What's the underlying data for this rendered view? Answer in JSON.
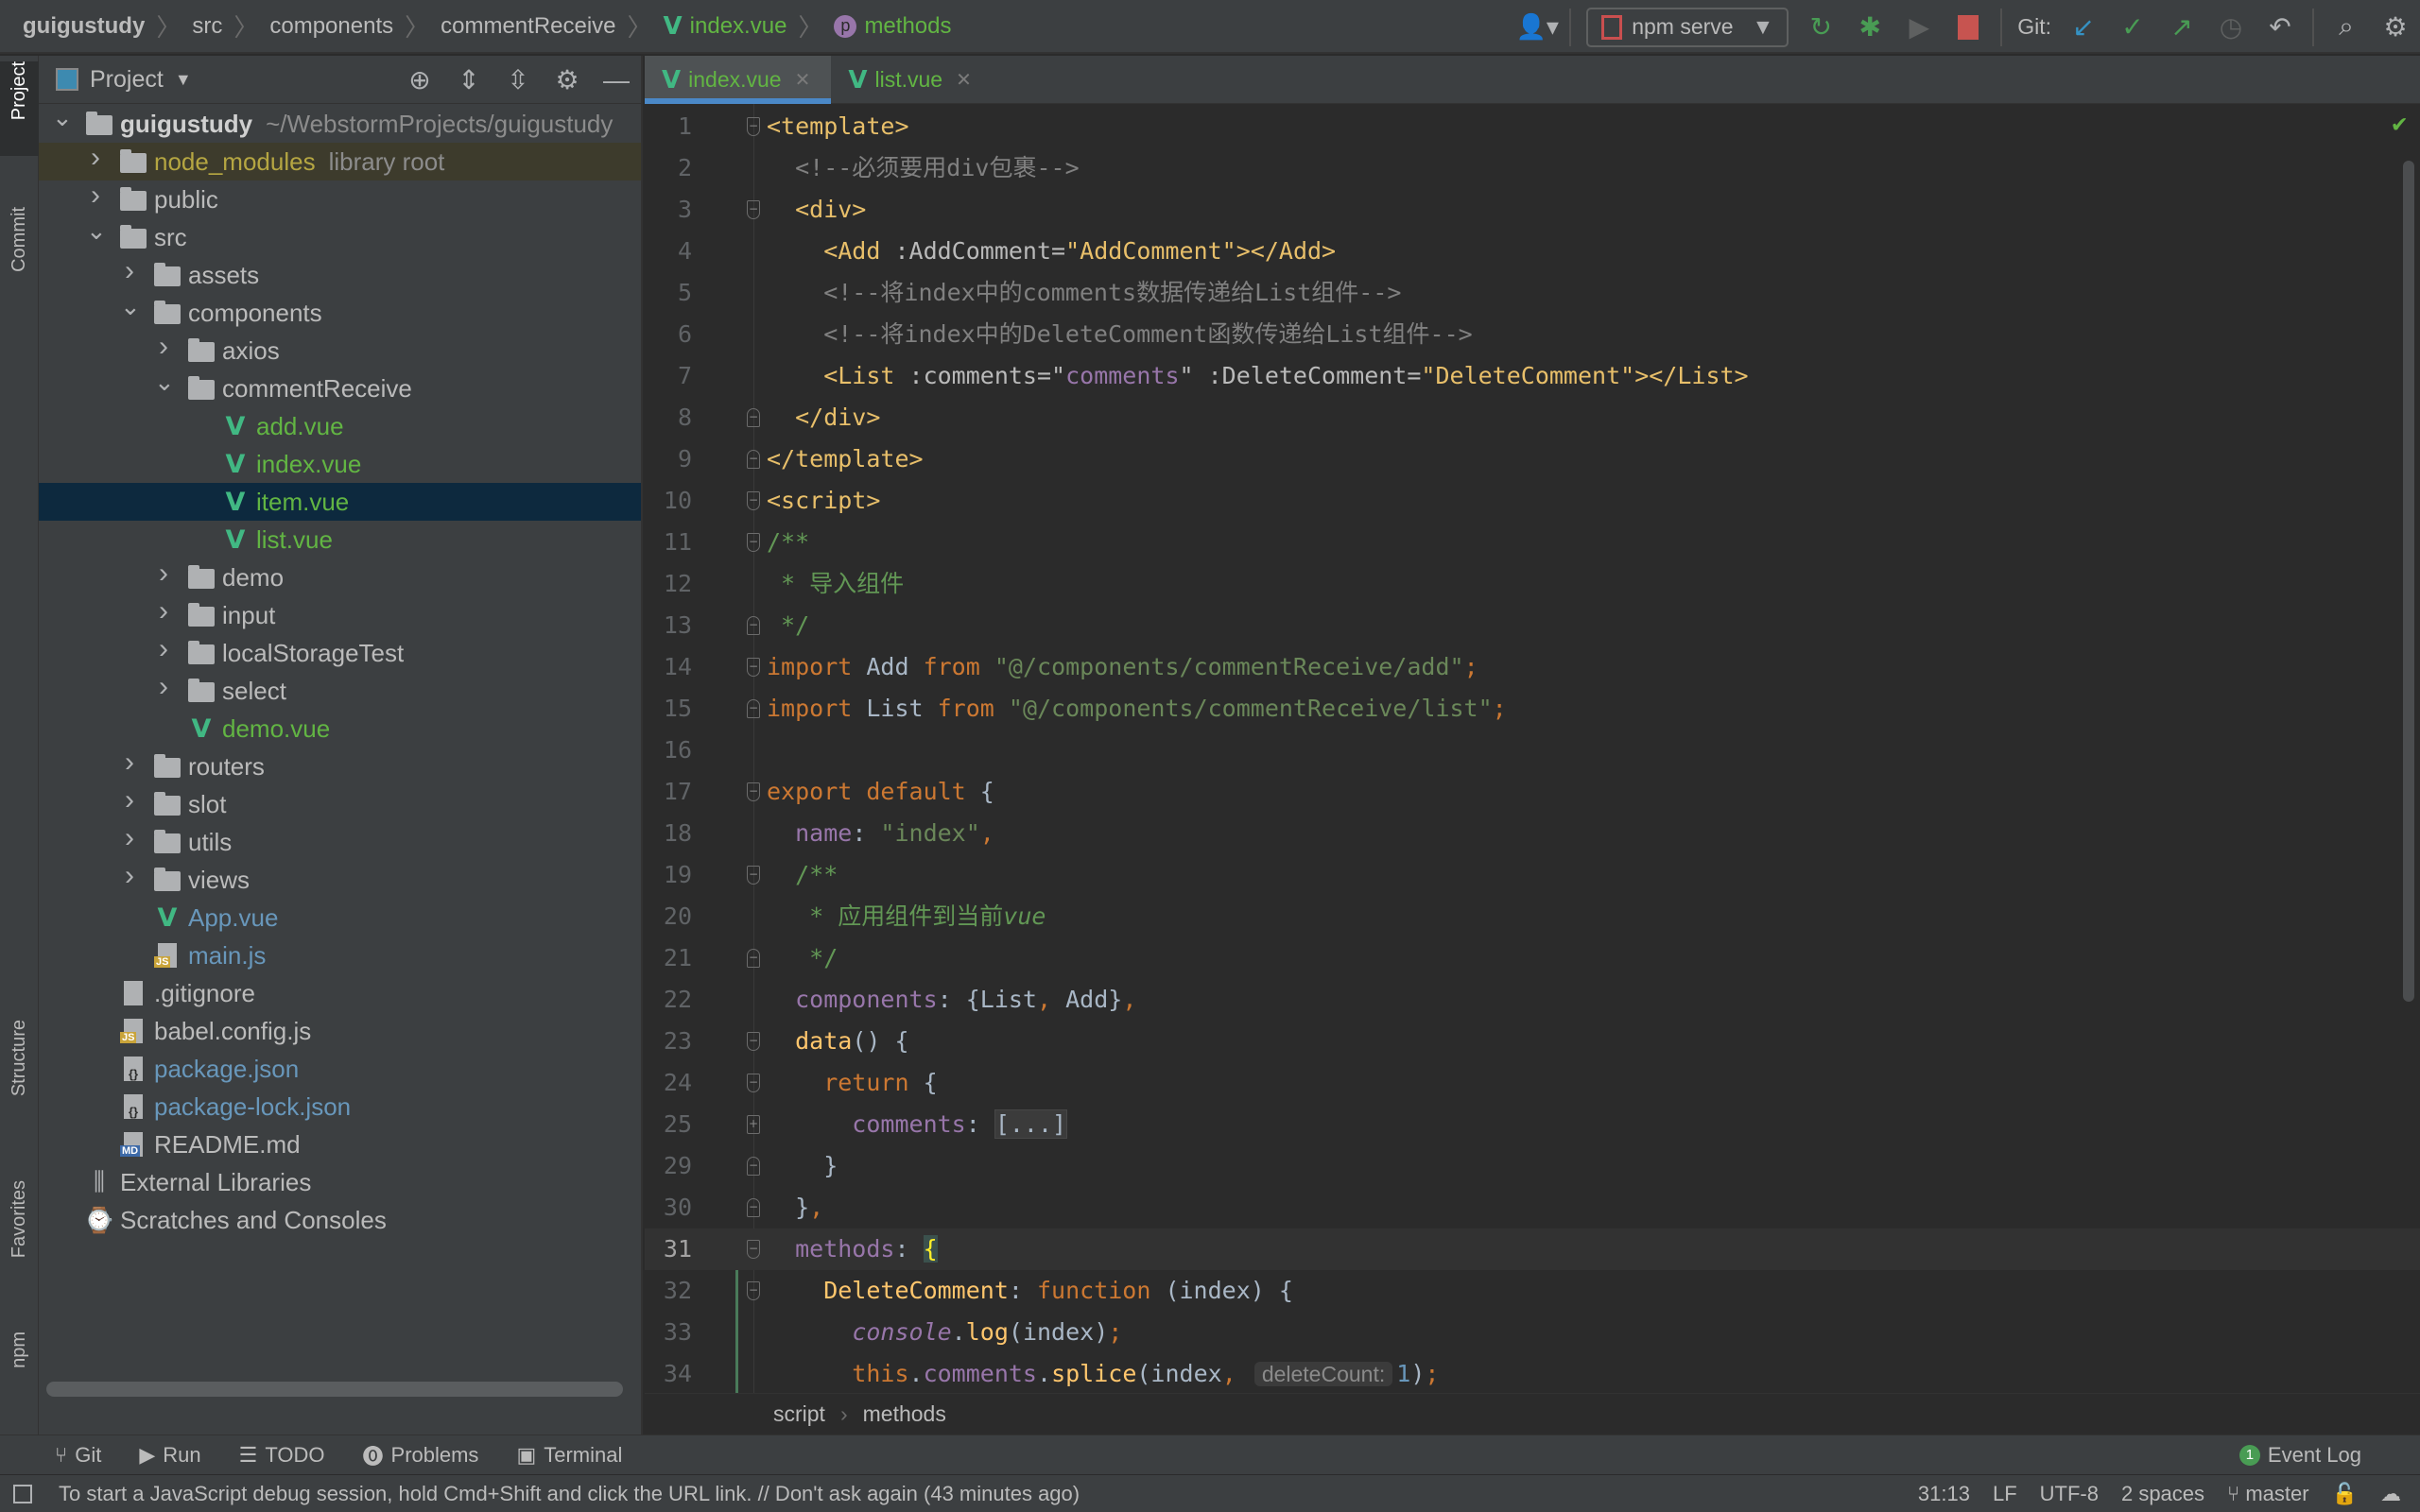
{
  "breadcrumb": {
    "items": [
      {
        "label": "guigustudy",
        "style": "bold"
      },
      {
        "label": "src",
        "style": ""
      },
      {
        "label": "components",
        "style": ""
      },
      {
        "label": "commentReceive",
        "style": ""
      },
      {
        "label": "index.vue",
        "style": "green",
        "icon": "vue-icon"
      },
      {
        "label": "methods",
        "style": "green",
        "icon": "property-icon"
      }
    ],
    "property_icon_letter": "p"
  },
  "toolbar": {
    "run_config": "npm serve",
    "git_label": "Git:"
  },
  "left_strip": [
    "Project",
    "Commit",
    "Structure",
    "Favorites",
    "npm"
  ],
  "project_panel": {
    "title": "Project",
    "tree": [
      {
        "label": "guigustudy",
        "extra": "~/WebstormProjects/guigustudy",
        "level": 0,
        "type": "folder",
        "state": "open",
        "bold": true
      },
      {
        "label": "node_modules",
        "extra": "library root",
        "level": 1,
        "type": "folder",
        "state": "closed",
        "color": "#b5a642",
        "lib": true
      },
      {
        "label": "public",
        "level": 1,
        "type": "folder",
        "state": "closed"
      },
      {
        "label": "src",
        "level": 1,
        "type": "folder",
        "state": "open"
      },
      {
        "label": "assets",
        "level": 2,
        "type": "folder",
        "state": "closed"
      },
      {
        "label": "components",
        "level": 2,
        "type": "folder",
        "state": "open"
      },
      {
        "label": "axios",
        "level": 3,
        "type": "folder",
        "state": "closed"
      },
      {
        "label": "commentReceive",
        "level": 3,
        "type": "folder",
        "state": "open"
      },
      {
        "label": "add.vue",
        "level": 4,
        "type": "vue",
        "color": "#62b543"
      },
      {
        "label": "index.vue",
        "level": 4,
        "type": "vue",
        "color": "#62b543"
      },
      {
        "label": "item.vue",
        "level": 4,
        "type": "vue",
        "color": "#62b543",
        "selected": true
      },
      {
        "label": "list.vue",
        "level": 4,
        "type": "vue",
        "color": "#62b543"
      },
      {
        "label": "demo",
        "level": 3,
        "type": "folder",
        "state": "closed"
      },
      {
        "label": "input",
        "level": 3,
        "type": "folder",
        "state": "closed"
      },
      {
        "label": "localStorageTest",
        "level": 3,
        "type": "folder",
        "state": "closed"
      },
      {
        "label": "select",
        "level": 3,
        "type": "folder",
        "state": "closed"
      },
      {
        "label": "demo.vue",
        "level": 3,
        "type": "vue",
        "color": "#62b543"
      },
      {
        "label": "routers",
        "level": 2,
        "type": "folder",
        "state": "closed"
      },
      {
        "label": "slot",
        "level": 2,
        "type": "folder",
        "state": "closed"
      },
      {
        "label": "utils",
        "level": 2,
        "type": "folder",
        "state": "closed"
      },
      {
        "label": "views",
        "level": 2,
        "type": "folder",
        "state": "closed"
      },
      {
        "label": "App.vue",
        "level": 2,
        "type": "vue",
        "color": "#6897bb"
      },
      {
        "label": "main.js",
        "level": 2,
        "type": "js",
        "color": "#6897bb"
      },
      {
        "label": ".gitignore",
        "level": 1,
        "type": "file"
      },
      {
        "label": "babel.config.js",
        "level": 1,
        "type": "js"
      },
      {
        "label": "package.json",
        "level": 1,
        "type": "json",
        "color": "#6897bb"
      },
      {
        "label": "package-lock.json",
        "level": 1,
        "type": "json",
        "color": "#6897bb"
      },
      {
        "label": "README.md",
        "level": 1,
        "type": "md"
      },
      {
        "label": "External Libraries",
        "level": 0,
        "type": "libs"
      },
      {
        "label": "Scratches and Consoles",
        "level": 0,
        "type": "scratch"
      }
    ]
  },
  "tabs": [
    {
      "label": "index.vue",
      "active": true
    },
    {
      "label": "list.vue",
      "active": false
    }
  ],
  "editor": {
    "current_line": "31",
    "lines": [
      {
        "n": "1",
        "fold": "open",
        "t": [
          [
            "<template>",
            "tag"
          ]
        ]
      },
      {
        "n": "2",
        "t": [
          [
            "  <!--必须要用div包裹-->",
            "cm"
          ]
        ]
      },
      {
        "n": "3",
        "fold": "open",
        "t": [
          [
            "  <div>",
            "tag"
          ]
        ]
      },
      {
        "n": "4",
        "t": [
          [
            "    <Add",
            "tag"
          ],
          [
            " :AddComment",
            "attr"
          ],
          [
            "=",
            "attr"
          ],
          [
            "\"AddComment\"",
            "tag"
          ],
          [
            "></Add>",
            "tag"
          ]
        ]
      },
      {
        "n": "5",
        "t": [
          [
            "    <!--将index中的comments数据传递给List组件-->",
            "cm"
          ]
        ]
      },
      {
        "n": "6",
        "t": [
          [
            "    <!--将index中的DeleteComment函数传递给List组件-->",
            "cm"
          ]
        ]
      },
      {
        "n": "7",
        "t": [
          [
            "    <List",
            "tag"
          ],
          [
            " :comments",
            "attr"
          ],
          [
            "=\"",
            "attr"
          ],
          [
            "comments",
            "vattr"
          ],
          [
            "\"",
            "attr"
          ],
          [
            " :DeleteComment",
            "attr"
          ],
          [
            "=",
            "attr"
          ],
          [
            "\"DeleteComment\"",
            "tag"
          ],
          [
            "></List>",
            "tag"
          ]
        ]
      },
      {
        "n": "8",
        "fold": "close",
        "t": [
          [
            "  </div>",
            "tag"
          ]
        ]
      },
      {
        "n": "9",
        "fold": "close",
        "t": [
          [
            "</template>",
            "tag"
          ]
        ]
      },
      {
        "n": "10",
        "fold": "open",
        "t": [
          [
            "<script>",
            "tag"
          ]
        ]
      },
      {
        "n": "11",
        "fold": "open",
        "t": [
          [
            "/**",
            "doc"
          ]
        ]
      },
      {
        "n": "12",
        "t": [
          [
            " * 导入组件",
            "doc"
          ]
        ]
      },
      {
        "n": "13",
        "fold": "close",
        "t": [
          [
            " */",
            "doc"
          ]
        ]
      },
      {
        "n": "14",
        "fold": "open",
        "t": [
          [
            "import",
            "kw"
          ],
          [
            " Add ",
            "def"
          ],
          [
            "from",
            "kw"
          ],
          [
            " ",
            "def"
          ],
          [
            "\"@/components/commentReceive/add\"",
            "str"
          ],
          [
            ";",
            "kw"
          ]
        ]
      },
      {
        "n": "15",
        "fold": "close",
        "t": [
          [
            "import",
            "kw"
          ],
          [
            " List ",
            "def"
          ],
          [
            "from",
            "kw"
          ],
          [
            " ",
            "def"
          ],
          [
            "\"@/components/commentReceive/list\"",
            "str"
          ],
          [
            ";",
            "kw"
          ]
        ]
      },
      {
        "n": "16",
        "t": []
      },
      {
        "n": "17",
        "fold": "open",
        "t": [
          [
            "export default",
            "kw"
          ],
          [
            " {",
            "def"
          ]
        ]
      },
      {
        "n": "18",
        "t": [
          [
            "  name",
            "prop"
          ],
          [
            ": ",
            "def"
          ],
          [
            "\"index\"",
            "str"
          ],
          [
            ",",
            "kw"
          ]
        ]
      },
      {
        "n": "19",
        "fold": "open",
        "t": [
          [
            "  /**",
            "doc"
          ]
        ]
      },
      {
        "n": "20",
        "t": [
          [
            "   * 应用组件到当前",
            "doc"
          ],
          [
            "vue",
            "doci"
          ]
        ]
      },
      {
        "n": "21",
        "fold": "close",
        "t": [
          [
            "   */",
            "doc"
          ]
        ]
      },
      {
        "n": "22",
        "t": [
          [
            "  components",
            "prop"
          ],
          [
            ": {List",
            "def"
          ],
          [
            ",",
            "kw"
          ],
          [
            " Add}",
            "def"
          ],
          [
            ",",
            "kw"
          ]
        ]
      },
      {
        "n": "23",
        "fold": "open",
        "t": [
          [
            "  data",
            "fn"
          ],
          [
            "() {",
            "def"
          ]
        ]
      },
      {
        "n": "24",
        "fold": "open",
        "t": [
          [
            "    return",
            "kw"
          ],
          [
            " {",
            "def"
          ]
        ]
      },
      {
        "n": "25",
        "fold": "expand",
        "t": [
          [
            "      comments",
            "prop"
          ],
          [
            ": ",
            "def"
          ],
          [
            "[...]",
            "fold"
          ]
        ]
      },
      {
        "n": "29",
        "fold": "close",
        "t": [
          [
            "    }",
            "def"
          ]
        ]
      },
      {
        "n": "30",
        "fold": "close",
        "t": [
          [
            "  }",
            "def"
          ],
          [
            ",",
            "kw"
          ]
        ]
      },
      {
        "n": "31",
        "fold": "open",
        "t": [
          [
            "  methods",
            "prop"
          ],
          [
            ": ",
            "def"
          ],
          [
            "{",
            "brace"
          ]
        ]
      },
      {
        "n": "32",
        "fold": "open",
        "t": [
          [
            "    DeleteComment",
            "fn"
          ],
          [
            ": ",
            "def"
          ],
          [
            "function",
            "kw"
          ],
          [
            " (index) {",
            "def"
          ]
        ]
      },
      {
        "n": "33",
        "t": [
          [
            "      ",
            "def"
          ],
          [
            "console",
            "ital"
          ],
          [
            ".",
            "def"
          ],
          [
            "log",
            "fn"
          ],
          [
            "(index)",
            "def"
          ],
          [
            ";",
            "kw"
          ]
        ]
      },
      {
        "n": "34",
        "t": [
          [
            "      this",
            "kw"
          ],
          [
            ".",
            "def"
          ],
          [
            "comments",
            "prop"
          ],
          [
            ".",
            "def"
          ],
          [
            "splice",
            "fn"
          ],
          [
            "(index",
            "def"
          ],
          [
            ",",
            "kw"
          ],
          [
            " ",
            "def"
          ],
          [
            "deleteCount:",
            "hint"
          ],
          [
            "1",
            "num"
          ],
          [
            ")",
            "def"
          ],
          [
            ";",
            "kw"
          ]
        ]
      }
    ]
  },
  "editor_breadcrumb": [
    "script",
    "methods"
  ],
  "bottom_tools": [
    {
      "label": "Git",
      "icon": "git-icon"
    },
    {
      "label": "Run",
      "icon": "run-icon"
    },
    {
      "label": "TODO",
      "icon": "todo-icon"
    },
    {
      "label": "Problems",
      "icon": "problems-icon"
    },
    {
      "label": "Terminal",
      "icon": "terminal-icon"
    }
  ],
  "event_log": {
    "label": "Event Log",
    "count": "1"
  },
  "status": {
    "message": "To start a JavaScript debug session, hold Cmd+Shift and click the URL link. // Don't ask again (43 minutes ago)",
    "position": "31:13",
    "line_sep": "LF",
    "encoding": "UTF-8",
    "indent": "2 spaces",
    "branch": "master"
  }
}
